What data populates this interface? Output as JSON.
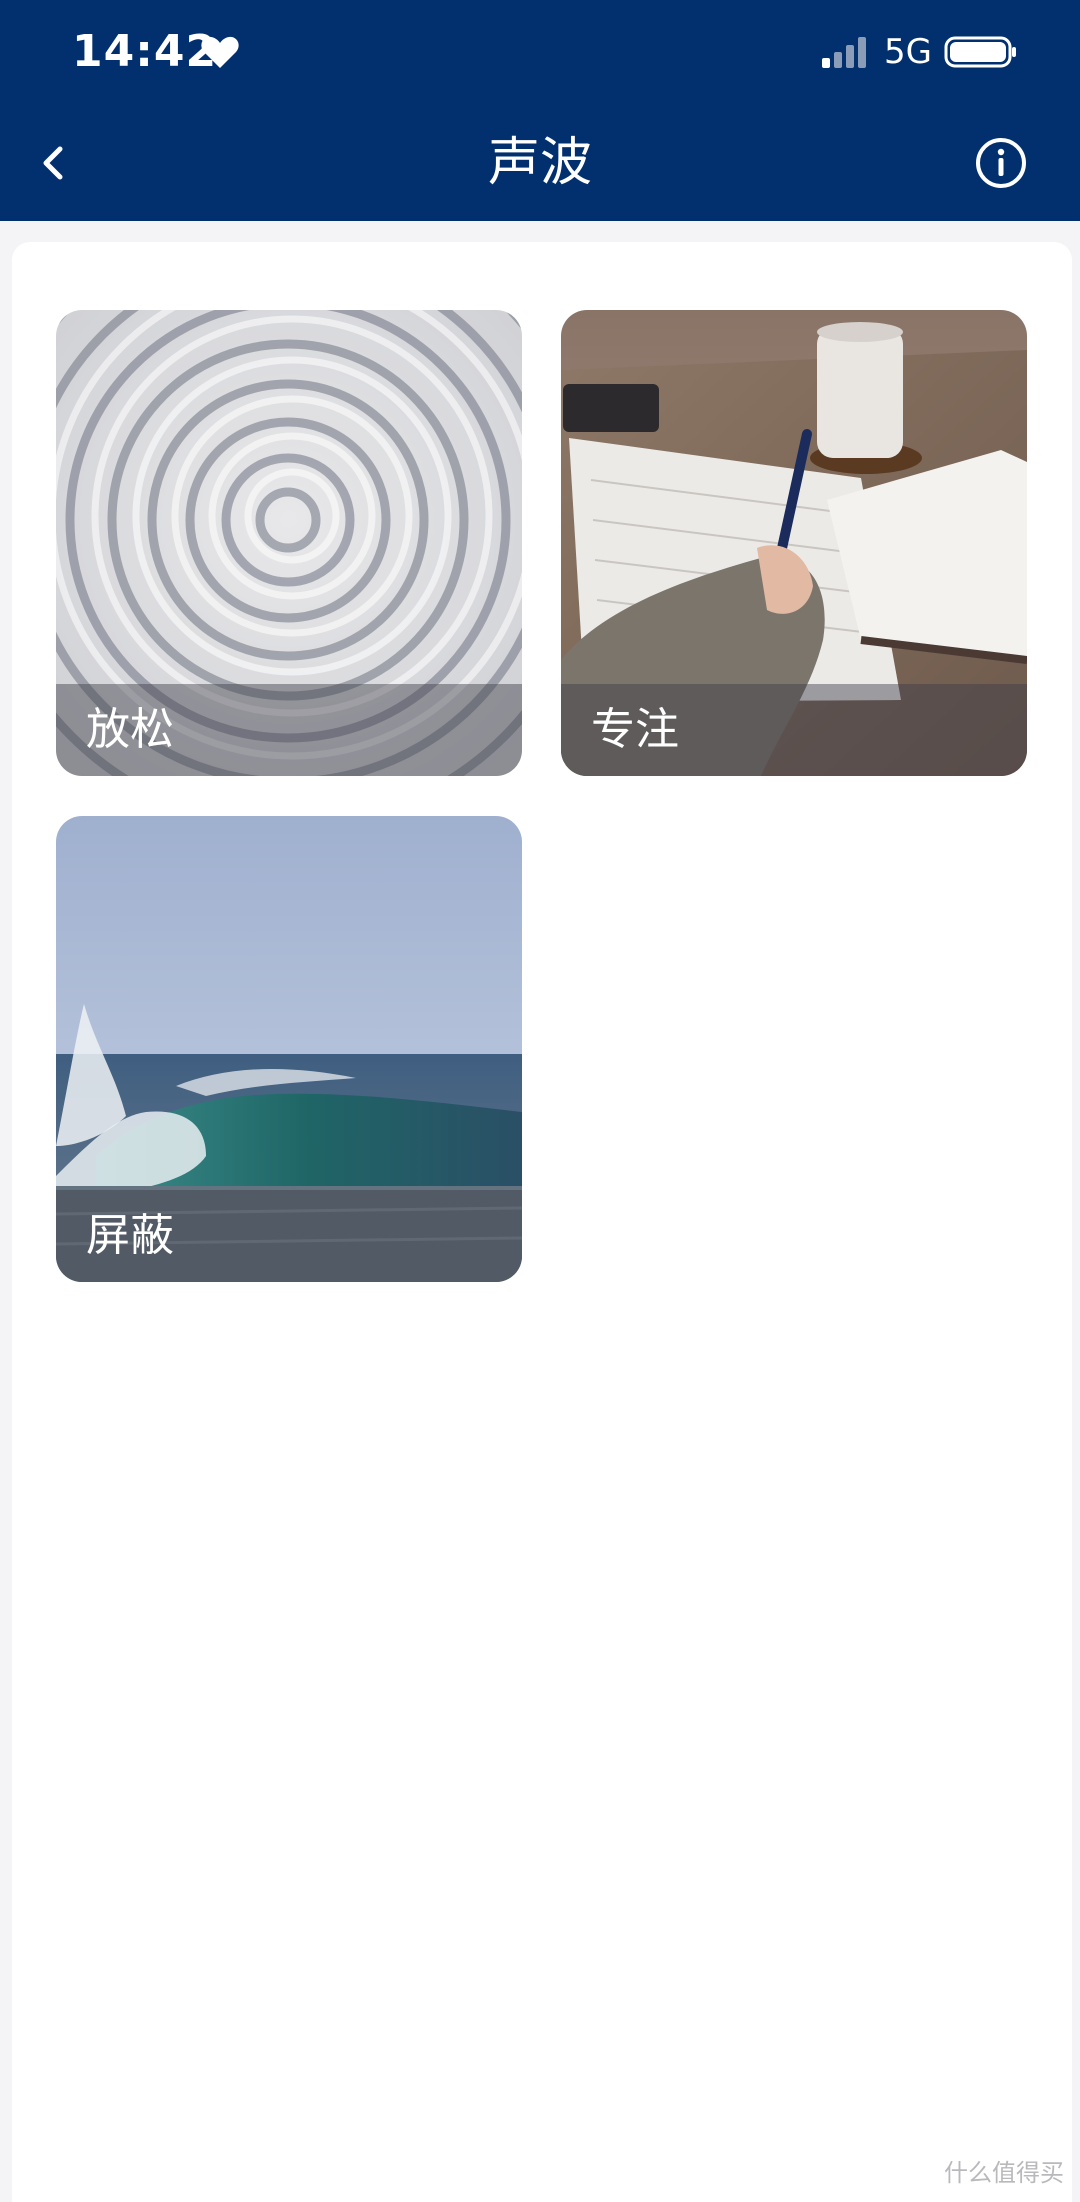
{
  "status_bar": {
    "time": "14:42",
    "network": "5G",
    "icons": [
      "heart-icon",
      "signal-icon",
      "battery-icon"
    ]
  },
  "nav": {
    "title": "声波",
    "back_icon": "chevron-left-icon",
    "info_icon": "info-icon"
  },
  "cards": [
    {
      "label": "放松",
      "image": "sand-ripple-image"
    },
    {
      "label": "专注",
      "image": "writing-desk-image"
    },
    {
      "label": "屏蔽",
      "image": "ocean-wave-image"
    }
  ],
  "watermark": "什么值得买",
  "colors": {
    "header_bg": "#02306f",
    "page_bg": "#f4f4f6",
    "card_bg": "#ffffff",
    "label_text": "#ffffff"
  }
}
